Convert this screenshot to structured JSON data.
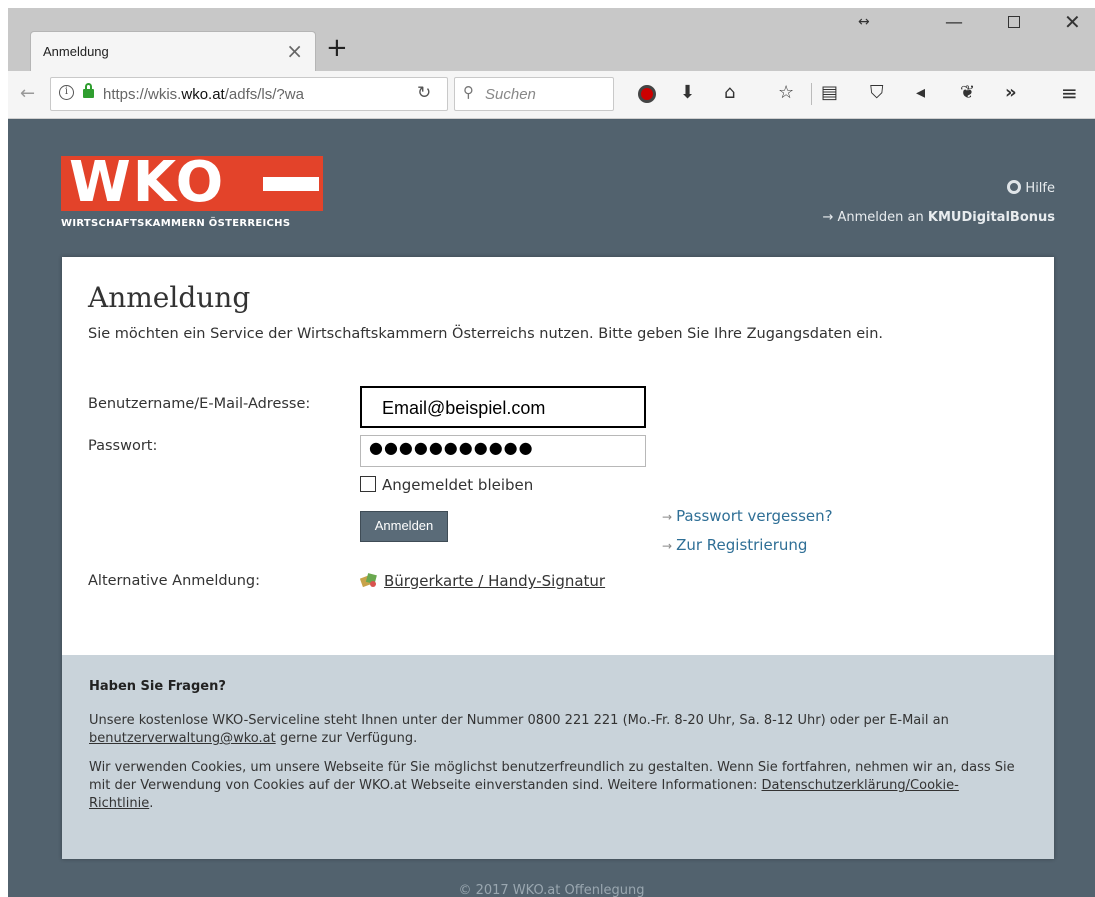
{
  "browser": {
    "tab_title": "Anmeldung",
    "url_prefix": "https://wkis.",
    "url_domain": "wko.at",
    "url_suffix": "/adfs/ls/?wa",
    "search_placeholder": "Suchen"
  },
  "header": {
    "logo_letters": "WKO",
    "logo_subtitle": "WIRTSCHAFTSKAMMERN ÖSTERREICHS",
    "help_label": "Hilfe",
    "kmu_prefix": "Anmelden an ",
    "kmu_strong": "KMUDigitalBonus"
  },
  "login": {
    "title": "Anmeldung",
    "intro": "Sie möchten ein Service der Wirtschaftskammern Österreichs nutzen. Bitte geben Sie Ihre Zugangsdaten ein.",
    "username_label": "Benutzername/E-Mail-Adresse:",
    "username_value": "Email@beispiel.com",
    "password_label": "Passwort:",
    "password_mask": "●●●●●●●●●●●",
    "remember_label": "Angemeldet bleiben",
    "submit_label": "Anmelden",
    "forgot_label": "Passwort vergessen?",
    "register_label": "Zur Registrierung",
    "alt_label": "Alternative Anmeldung:",
    "alt_link": "Bürgerkarte / Handy-Signatur"
  },
  "footer": {
    "heading": "Haben Sie Fragen?",
    "p1_a": "Unsere kostenlose WKO-Serviceline steht Ihnen unter der Nummer 0800 221 221 (Mo.-Fr. 8-20 Uhr, Sa. 8-12 Uhr) oder per E-Mail an ",
    "p1_link": "benutzerverwaltung@wko.at",
    "p1_b": " gerne zur Verfügung.",
    "p2_a": "Wir verwenden Cookies, um unsere Webseite für Sie möglichst benutzerfreundlich zu gestalten. Wenn Sie fortfahren, nehmen wir an, dass Sie mit der Verwendung von Cookies auf der WKO.at Webseite einverstanden sind. Weitere Informationen: ",
    "p2_link": "Datenschutzerklärung/Cookie-Richtlinie",
    "p2_b": ".",
    "copyright": "© 2017 WKO.at Offenlegung"
  },
  "colors": {
    "brand_red": "#e3432a",
    "page_bg": "#52626e",
    "link": "#2f6f96"
  }
}
